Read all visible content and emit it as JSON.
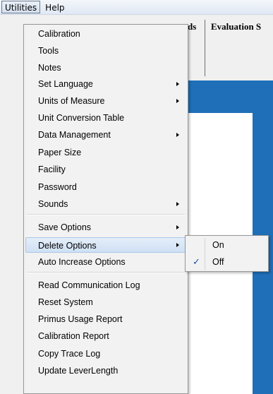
{
  "menubar": {
    "items": [
      {
        "label": "Utilities"
      },
      {
        "label": "Help"
      }
    ]
  },
  "background": {
    "tabs": [
      {
        "label": "ds"
      },
      {
        "label": "Evaluation S"
      }
    ],
    "colors": {
      "panel": "#1e6fb8"
    }
  },
  "menu": {
    "items": [
      {
        "label": "Calibration",
        "submenu": false
      },
      {
        "label": "Tools",
        "submenu": false
      },
      {
        "label": "Notes",
        "submenu": false
      },
      {
        "label": "Set Language",
        "submenu": true
      },
      {
        "label": "Units of Measure",
        "submenu": true
      },
      {
        "label": "Unit Conversion Table",
        "submenu": false
      },
      {
        "label": "Data Management",
        "submenu": true
      },
      {
        "label": "Paper Size",
        "submenu": false
      },
      {
        "label": "Facility",
        "submenu": false
      },
      {
        "label": "Password",
        "submenu": false
      },
      {
        "label": "Sounds",
        "submenu": true
      },
      {
        "label": "Save Options",
        "submenu": true
      },
      {
        "label": "Delete Options",
        "submenu": true,
        "highlighted": true
      },
      {
        "label": "Auto Increase Options",
        "submenu": false
      },
      {
        "label": "Read Communication Log",
        "submenu": false
      },
      {
        "label": "Reset System",
        "submenu": false
      },
      {
        "label": "Primus Usage Report",
        "submenu": false
      },
      {
        "label": "Calibration Report",
        "submenu": false
      },
      {
        "label": "Copy Trace Log",
        "submenu": false
      },
      {
        "label": "Update LeverLength",
        "submenu": false
      }
    ]
  },
  "submenu": {
    "items": [
      {
        "label": "On",
        "checked": false
      },
      {
        "label": "Off",
        "checked": true
      }
    ],
    "check_glyph": "✓"
  }
}
